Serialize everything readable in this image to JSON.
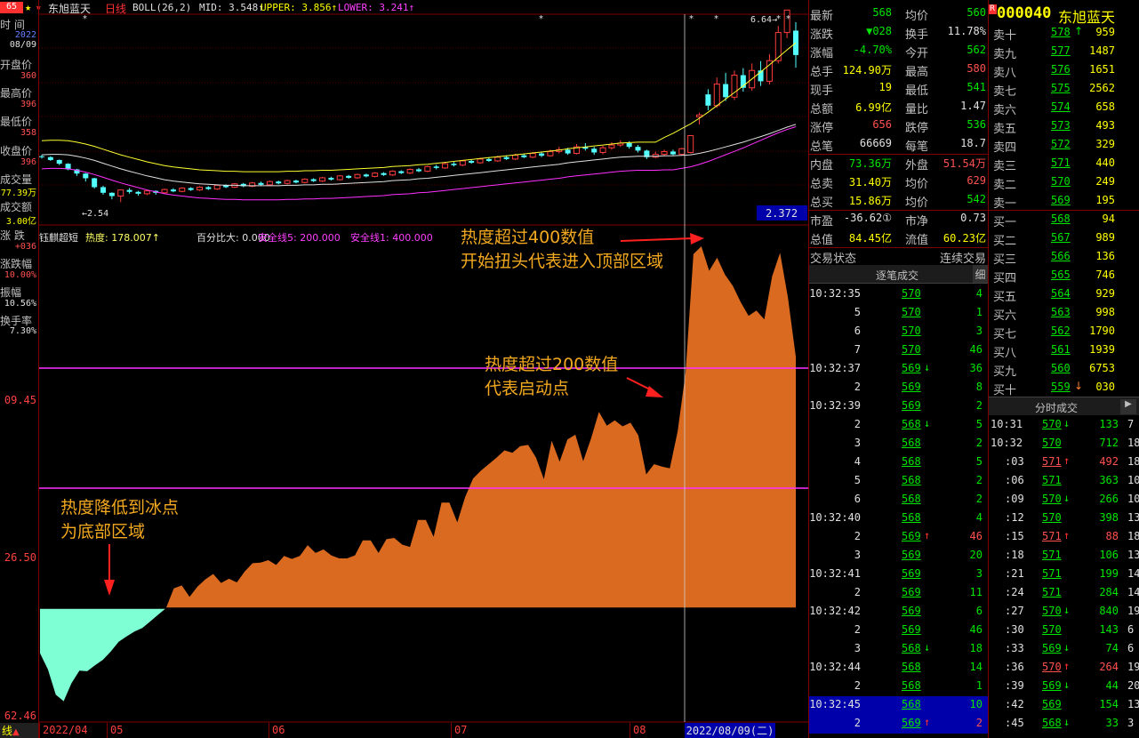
{
  "header": {
    "code_badge": "65",
    "stock_name": "东旭蓝天",
    "period": "日线",
    "boll_label": "BOLL(26,2)",
    "mid": "MID: 3.548↑",
    "upper": "UPPER: 3.856↑",
    "lower": "LOWER: 3.241↑"
  },
  "left_panel": {
    "time_label": "时 间",
    "date_year": "2022",
    "date_md": "08/09",
    "open_label": "开盘价",
    "open_val": "360",
    "high_label": "最高价",
    "high_val": "396",
    "low_label": "最低价",
    "low_val": "358",
    "close_label": "收盘价",
    "close_val": "396",
    "volume_label": "成交量",
    "volume_val": "77.39万",
    "amount_label": "成交额",
    "amount_val": "3.00亿",
    "change_label": "涨 跌",
    "change_val": "+036",
    "pct_label": "涨跌幅",
    "pct_val": "10.00%",
    "amp_label": "振幅",
    "amp_val": "10.56%",
    "turnover_label": "换手率",
    "turnover_val": "7.30%",
    "axis_top": "09.45",
    "axis_mid": "26.50",
    "axis_bottom": "62.46",
    "bottom_tab": "线"
  },
  "upper_chart": {
    "high_marker": "6.64",
    "low_marker": "2.54",
    "cursor_value": "2.372"
  },
  "indicator": {
    "name": "钰麒超短",
    "heat": "热度: 178.007↑",
    "ratio": "百分比大: 0.000",
    "safe5": "安全线5: 200.000",
    "safe1": "安全线1: 400.000"
  },
  "annotations": {
    "top_line1": "热度超过400数值",
    "top_line2": "开始扭头代表进入顶部区域",
    "start_line1": "热度超过200数值",
    "start_line2": "代表启动点",
    "bottom_line1": "热度降低到冰点",
    "bottom_line2": "为底部区域"
  },
  "x_axis": {
    "labels": [
      "2022/04",
      "05",
      "06",
      "07",
      "08"
    ],
    "cursor_date": "2022/08/09(二)"
  },
  "quote": {
    "rows": [
      {
        "l1": "最新",
        "v1": "568",
        "c1": "green",
        "l2": "均价",
        "v2": "560",
        "c2": "green"
      },
      {
        "l1": "涨跌",
        "v1": "▼028",
        "c1": "green",
        "l2": "换手",
        "v2": "11.78%",
        "c2": "white"
      },
      {
        "l1": "涨幅",
        "v1": "-4.70%",
        "c1": "green",
        "l2": "今开",
        "v2": "562",
        "c2": "green"
      },
      {
        "l1": "总手",
        "v1": "124.90万",
        "c1": "yellow",
        "l2": "最高",
        "v2": "580",
        "c2": "red"
      },
      {
        "l1": "现手",
        "v1": "19",
        "c1": "yellow",
        "l2": "最低",
        "v2": "541",
        "c2": "green"
      },
      {
        "l1": "总额",
        "v1": "6.99亿",
        "c1": "yellow",
        "l2": "量比",
        "v2": "1.47",
        "c2": "white"
      },
      {
        "l1": "涨停",
        "v1": "656",
        "c1": "red",
        "l2": "跌停",
        "v2": "536",
        "c2": "green"
      },
      {
        "l1": "总笔",
        "v1": "66669",
        "c1": "white",
        "l2": "每笔",
        "v2": "18.7",
        "c2": "white"
      },
      {
        "l1": "内盘",
        "v1": "73.36万",
        "c1": "green",
        "l2": "外盘",
        "v2": "51.54万",
        "c2": "red"
      },
      {
        "l1": "总卖",
        "v1": "31.40万",
        "c1": "yellow",
        "l2": "均价",
        "v2": "629",
        "c2": "red"
      },
      {
        "l1": "总买",
        "v1": "15.86万",
        "c1": "yellow",
        "l2": "均价",
        "v2": "542",
        "c2": "green"
      },
      {
        "l1": "市盈",
        "v1": "-36.62①",
        "c1": "white",
        "l2": "市净",
        "v2": "0.73",
        "c2": "white"
      },
      {
        "l1": "总值",
        "v1": "84.45亿",
        "c1": "yellow",
        "l2": "流值",
        "v2": "60.23亿",
        "c2": "yellow"
      },
      {
        "l1": "交易状态",
        "v1": "",
        "c1": "white",
        "l2": "连续交易",
        "v2": "",
        "c2": "white"
      }
    ]
  },
  "trades": {
    "header": "逐笔成交",
    "header_btn": "细",
    "rows": [
      {
        "t": "10:32:35",
        "p": "570",
        "a": "",
        "v": "4"
      },
      {
        "t": "5",
        "p": "570",
        "a": "",
        "v": "1"
      },
      {
        "t": "6",
        "p": "570",
        "a": "",
        "v": "3"
      },
      {
        "t": "7",
        "p": "570",
        "a": "",
        "v": "46"
      },
      {
        "t": "10:32:37",
        "p": "569",
        "a": "↓",
        "v": "36"
      },
      {
        "t": "2",
        "p": "569",
        "a": "",
        "v": "8"
      },
      {
        "t": "10:32:39",
        "p": "569",
        "a": "",
        "v": "2"
      },
      {
        "t": "2",
        "p": "568",
        "a": "↓",
        "v": "5"
      },
      {
        "t": "3",
        "p": "568",
        "a": "",
        "v": "2"
      },
      {
        "t": "4",
        "p": "568",
        "a": "",
        "v": "5"
      },
      {
        "t": "5",
        "p": "568",
        "a": "",
        "v": "2"
      },
      {
        "t": "6",
        "p": "568",
        "a": "",
        "v": "2"
      },
      {
        "t": "10:32:40",
        "p": "568",
        "a": "",
        "v": "4"
      },
      {
        "t": "2",
        "p": "569",
        "a": "↑",
        "v": "46"
      },
      {
        "t": "3",
        "p": "569",
        "a": "",
        "v": "20"
      },
      {
        "t": "10:32:41",
        "p": "569",
        "a": "",
        "v": "3"
      },
      {
        "t": "2",
        "p": "569",
        "a": "",
        "v": "11"
      },
      {
        "t": "10:32:42",
        "p": "569",
        "a": "",
        "v": "6"
      },
      {
        "t": "2",
        "p": "569",
        "a": "",
        "v": "46"
      },
      {
        "t": "3",
        "p": "568",
        "a": "↓",
        "v": "18"
      },
      {
        "t": "10:32:44",
        "p": "568",
        "a": "",
        "v": "14"
      },
      {
        "t": "2",
        "p": "568",
        "a": "",
        "v": "1"
      },
      {
        "t": "10:32:45",
        "p": "568",
        "a": "",
        "v": "10"
      },
      {
        "t": "2",
        "p": "569",
        "a": "↑",
        "v": "2"
      }
    ]
  },
  "book": {
    "code": "000040",
    "name": "东旭蓝天",
    "badge": "R",
    "sells": [
      {
        "l": "卖十",
        "p": "578",
        "v": "959",
        "a": "↑"
      },
      {
        "l": "卖九",
        "p": "577",
        "v": "1487",
        "a": ""
      },
      {
        "l": "卖八",
        "p": "576",
        "v": "1651",
        "a": ""
      },
      {
        "l": "卖七",
        "p": "575",
        "v": "2562",
        "a": ""
      },
      {
        "l": "卖六",
        "p": "574",
        "v": "658",
        "a": ""
      },
      {
        "l": "卖五",
        "p": "573",
        "v": "493",
        "a": ""
      },
      {
        "l": "卖四",
        "p": "572",
        "v": "329",
        "a": ""
      },
      {
        "l": "卖三",
        "p": "571",
        "v": "440",
        "a": ""
      },
      {
        "l": "卖二",
        "p": "570",
        "v": "249",
        "a": ""
      },
      {
        "l": "卖一",
        "p": "569",
        "v": "195",
        "a": ""
      }
    ],
    "buys": [
      {
        "l": "买一",
        "p": "568",
        "v": "94",
        "a": ""
      },
      {
        "l": "买二",
        "p": "567",
        "v": "989",
        "a": ""
      },
      {
        "l": "买三",
        "p": "566",
        "v": "136",
        "a": ""
      },
      {
        "l": "买四",
        "p": "565",
        "v": "746",
        "a": ""
      },
      {
        "l": "买五",
        "p": "564",
        "v": "929",
        "a": ""
      },
      {
        "l": "买六",
        "p": "563",
        "v": "998",
        "a": ""
      },
      {
        "l": "买七",
        "p": "562",
        "v": "1790",
        "a": ""
      },
      {
        "l": "买八",
        "p": "561",
        "v": "1939",
        "a": ""
      },
      {
        "l": "买九",
        "p": "560",
        "v": "6753",
        "a": ""
      },
      {
        "l": "买十",
        "p": "559",
        "v": "030",
        "a": "↓"
      }
    ],
    "minute_header": "分时成交",
    "minute_rows": [
      {
        "t": "10:31",
        "p": "570",
        "a": "↓",
        "v": "133",
        "x": "7"
      },
      {
        "t": "10:32",
        "p": "570",
        "a": "",
        "v": "712",
        "x": "18"
      },
      {
        "t": ":03",
        "p": "571",
        "a": "↑",
        "v": "492",
        "x": "18"
      },
      {
        "t": ":06",
        "p": "571",
        "a": "",
        "v": "363",
        "x": "10"
      },
      {
        "t": ":09",
        "p": "570",
        "a": "↓",
        "v": "266",
        "x": "10"
      },
      {
        "t": ":12",
        "p": "570",
        "a": "",
        "v": "398",
        "x": "13"
      },
      {
        "t": ":15",
        "p": "571",
        "a": "↑",
        "v": "88",
        "x": "18"
      },
      {
        "t": ":18",
        "p": "571",
        "a": "",
        "v": "106",
        "x": "13"
      },
      {
        "t": ":21",
        "p": "571",
        "a": "",
        "v": "199",
        "x": "14"
      },
      {
        "t": ":24",
        "p": "571",
        "a": "",
        "v": "284",
        "x": "14"
      },
      {
        "t": ":27",
        "p": "570",
        "a": "↓",
        "v": "840",
        "x": "19"
      },
      {
        "t": ":30",
        "p": "570",
        "a": "",
        "v": "143",
        "x": "6"
      },
      {
        "t": ":33",
        "p": "569",
        "a": "↓",
        "v": "74",
        "x": "6"
      },
      {
        "t": ":36",
        "p": "570",
        "a": "↑",
        "v": "264",
        "x": "19"
      },
      {
        "t": ":39",
        "p": "569",
        "a": "↓",
        "v": "44",
        "x": "20"
      },
      {
        "t": ":42",
        "p": "569",
        "a": "",
        "v": "154",
        "x": "13"
      },
      {
        "t": ":45",
        "p": "568",
        "a": "↓",
        "v": "33",
        "x": "3"
      }
    ]
  },
  "chart_data": {
    "type": "area",
    "heat_series": [
      -75,
      -102,
      -144,
      -155,
      -125,
      -104,
      -105,
      -95,
      -86,
      -72,
      -56,
      -47,
      -39,
      -33,
      -22,
      -11,
      0,
      33,
      38,
      19,
      36,
      48,
      57,
      42,
      49,
      43,
      61,
      75,
      76,
      80,
      72,
      87,
      82,
      87,
      105,
      92,
      98,
      88,
      83,
      83,
      88,
      113,
      113,
      92,
      115,
      117,
      106,
      102,
      147,
      147,
      119,
      176,
      176,
      143,
      185,
      216,
      229,
      240,
      251,
      263,
      259,
      270,
      272,
      251,
      215,
      279,
      244,
      281,
      289,
      245,
      283,
      327,
      304,
      313,
      303,
      309,
      288,
      223,
      240,
      236,
      233,
      295,
      392,
      590,
      603,
      562,
      584,
      556,
      537,
      510,
      487,
      496,
      481,
      553,
      592,
      518,
      419
    ],
    "safe_line_low": 200,
    "safe_line_high": 400,
    "y_ticks": [
      "09.45",
      "26.50",
      "62.46"
    ],
    "candles": [
      [
        3.52,
        3.5,
        3.55,
        3.47
      ],
      [
        3.5,
        3.44,
        3.52,
        3.42
      ],
      [
        3.44,
        3.36,
        3.45,
        3.33
      ],
      [
        3.36,
        3.24,
        3.37,
        3.22
      ],
      [
        3.24,
        3.15,
        3.25,
        3.1
      ],
      [
        3.15,
        3.05,
        3.16,
        2.98
      ],
      [
        3.05,
        2.86,
        3.06,
        2.83
      ],
      [
        2.86,
        2.74,
        2.89,
        2.7
      ],
      [
        2.74,
        2.67,
        2.75,
        2.6
      ],
      [
        2.67,
        2.8,
        2.81,
        2.54
      ],
      [
        2.8,
        2.76,
        2.84,
        2.72
      ],
      [
        2.76,
        2.72,
        2.78,
        2.68
      ],
      [
        2.72,
        2.78,
        2.8,
        2.69
      ],
      [
        2.78,
        2.74,
        2.79,
        2.7
      ],
      [
        2.74,
        2.81,
        2.83,
        2.72
      ],
      [
        2.81,
        2.77,
        2.84,
        2.75
      ],
      [
        2.77,
        2.84,
        2.86,
        2.75
      ],
      [
        2.84,
        2.8,
        2.86,
        2.78
      ],
      [
        2.8,
        2.86,
        2.88,
        2.78
      ],
      [
        2.86,
        2.82,
        2.88,
        2.8
      ],
      [
        2.82,
        2.9,
        2.92,
        2.8
      ],
      [
        2.9,
        2.86,
        2.92,
        2.84
      ],
      [
        2.86,
        2.93,
        2.95,
        2.84
      ],
      [
        2.93,
        2.88,
        2.95,
        2.86
      ],
      [
        2.88,
        2.95,
        2.97,
        2.86
      ],
      [
        2.95,
        2.91,
        2.98,
        2.89
      ],
      [
        2.91,
        2.98,
        3.0,
        2.89
      ],
      [
        2.98,
        2.94,
        3.0,
        2.92
      ],
      [
        2.94,
        3.0,
        3.02,
        2.92
      ],
      [
        3.0,
        2.96,
        3.02,
        2.94
      ],
      [
        2.96,
        3.03,
        3.05,
        2.94
      ],
      [
        3.03,
        2.99,
        3.05,
        2.97
      ],
      [
        2.99,
        3.06,
        3.08,
        2.97
      ],
      [
        3.06,
        3.02,
        3.08,
        3.0
      ],
      [
        3.02,
        3.1,
        3.12,
        3.0
      ],
      [
        3.1,
        3.06,
        3.12,
        3.04
      ],
      [
        3.06,
        3.13,
        3.15,
        3.04
      ],
      [
        3.13,
        3.09,
        3.15,
        3.07
      ],
      [
        3.09,
        3.16,
        3.18,
        3.07
      ],
      [
        3.16,
        3.12,
        3.18,
        3.1
      ],
      [
        3.12,
        3.2,
        3.22,
        3.1
      ],
      [
        3.2,
        3.16,
        3.22,
        3.14
      ],
      [
        3.16,
        3.24,
        3.26,
        3.14
      ],
      [
        3.24,
        3.2,
        3.27,
        3.18
      ],
      [
        3.2,
        3.3,
        3.32,
        3.18
      ],
      [
        3.3,
        3.27,
        3.34,
        3.24
      ],
      [
        3.27,
        3.36,
        3.38,
        3.25
      ],
      [
        3.36,
        3.33,
        3.4,
        3.3
      ],
      [
        3.33,
        3.42,
        3.44,
        3.31
      ],
      [
        3.42,
        3.38,
        3.45,
        3.36
      ],
      [
        3.38,
        3.46,
        3.49,
        3.36
      ],
      [
        3.46,
        3.42,
        3.5,
        3.4
      ],
      [
        3.42,
        3.5,
        3.53,
        3.4
      ],
      [
        3.5,
        3.46,
        3.54,
        3.44
      ],
      [
        3.46,
        3.54,
        3.57,
        3.44
      ],
      [
        3.54,
        3.5,
        3.58,
        3.48
      ],
      [
        3.5,
        3.58,
        3.61,
        3.48
      ],
      [
        3.58,
        3.53,
        3.62,
        3.5
      ],
      [
        3.53,
        3.62,
        3.66,
        3.51
      ],
      [
        3.62,
        3.66,
        3.72,
        3.58
      ],
      [
        3.66,
        3.58,
        3.7,
        3.55
      ],
      [
        3.58,
        3.72,
        3.78,
        3.56
      ],
      [
        3.72,
        3.68,
        3.8,
        3.64
      ],
      [
        3.68,
        3.6,
        3.72,
        3.55
      ],
      [
        3.6,
        3.7,
        3.74,
        3.56
      ],
      [
        3.7,
        3.76,
        3.82,
        3.66
      ],
      [
        3.76,
        3.8,
        3.86,
        3.72
      ],
      [
        3.8,
        3.72,
        3.84,
        3.68
      ],
      [
        3.72,
        3.64,
        3.76,
        3.6
      ],
      [
        3.64,
        3.5,
        3.66,
        3.46
      ],
      [
        3.5,
        3.56,
        3.62,
        3.48
      ],
      [
        3.56,
        3.62,
        3.66,
        3.52
      ],
      [
        3.62,
        3.56,
        3.66,
        3.54
      ],
      [
        3.56,
        3.68,
        3.7,
        3.54
      ],
      [
        3.6,
        3.96,
        3.96,
        3.58
      ],
      [
        4.36,
        4.4,
        4.45,
        4.2
      ],
      [
        4.84,
        4.6,
        4.95,
        4.5
      ],
      [
        4.6,
        5.06,
        5.2,
        4.55
      ],
      [
        5.06,
        4.78,
        5.3,
        4.7
      ],
      [
        4.78,
        5.25,
        5.35,
        4.72
      ],
      [
        5.25,
        4.98,
        5.4,
        4.9
      ],
      [
        4.98,
        5.35,
        5.5,
        4.92
      ],
      [
        5.35,
        5.12,
        5.55,
        5.02
      ],
      [
        5.12,
        5.56,
        5.7,
        5.05
      ],
      [
        5.56,
        6.16,
        6.3,
        5.5
      ],
      [
        6.16,
        6.64,
        6.64,
        6.04
      ],
      [
        6.2,
        5.68,
        6.38,
        5.41
      ]
    ],
    "boll_mid": [
      3.55,
      3.56,
      3.56,
      3.55,
      3.52,
      3.48,
      3.43,
      3.37,
      3.31,
      3.25,
      3.2,
      3.15,
      3.1,
      3.06,
      3.02,
      2.99,
      2.97,
      2.95,
      2.93,
      2.92,
      2.91,
      2.9,
      2.9,
      2.89,
      2.89,
      2.89,
      2.89,
      2.89,
      2.9,
      2.9,
      2.91,
      2.91,
      2.92,
      2.92,
      2.93,
      2.94,
      2.95,
      2.96,
      2.97,
      2.98,
      3.0,
      3.01,
      3.02,
      3.04,
      3.05,
      3.07,
      3.09,
      3.11,
      3.13,
      3.15,
      3.17,
      3.19,
      3.21,
      3.23,
      3.25,
      3.27,
      3.29,
      3.31,
      3.33,
      3.35,
      3.38,
      3.4,
      3.42,
      3.44,
      3.46,
      3.48,
      3.5,
      3.51,
      3.52,
      3.52,
      3.52,
      3.53,
      3.53,
      3.54,
      3.55,
      3.58,
      3.62,
      3.67,
      3.72,
      3.77,
      3.82,
      3.88,
      3.94,
      4.0,
      4.07,
      4.14,
      4.2
    ]
  }
}
